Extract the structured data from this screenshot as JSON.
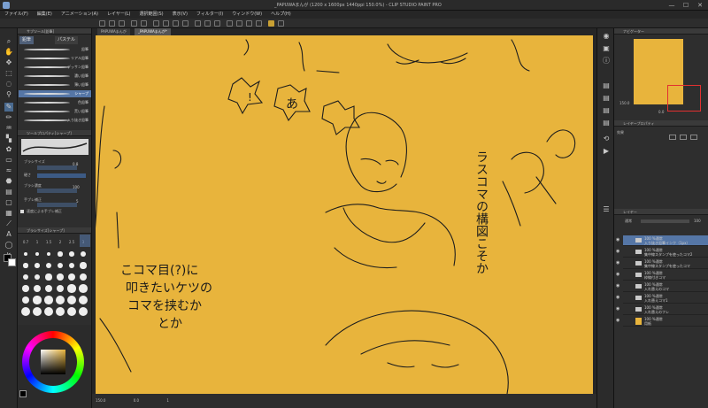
{
  "title": "_PAPUWAまんが (1200 x 1600px 1440ppi 150.0%) - CLIP STUDIO PAINT PRO",
  "menu": [
    "ファイル(F)",
    "編集(E)",
    "アニメーション(A)",
    "レイヤー(L)",
    "選択範囲(S)",
    "表示(V)",
    "フィルター(I)",
    "ウィンドウ(W)",
    "ヘルプ(H)"
  ],
  "window_buttons": [
    "—",
    "☐",
    "✕"
  ],
  "subtool": {
    "title": "サブツール[鉛筆]",
    "tabs": [
      "鉛筆",
      "パステル"
    ],
    "brushes": [
      "鉛筆",
      "リアル鉛筆",
      "デッサン鉛筆",
      "濃い鉛筆",
      "薄い鉛筆",
      "シャープ",
      "色鉛筆",
      "荒い鉛筆",
      "入り抜き鉛筆"
    ],
    "selected": "シャープ"
  },
  "toolprop": {
    "title": "ツールプロパティ[シャープ]",
    "brush_size_label": "ブラシサイズ",
    "brush_size_value": "0.8",
    "hardness_label": "硬さ",
    "density_label": "ブラシ濃度",
    "density_value": "100",
    "stabilization_label": "手ブレ補正",
    "stabilization_value": "5",
    "speed_label": "速度による手ブレ補正"
  },
  "brushsize": {
    "title": "ブラシサイズ[シャープ]",
    "sizes_row1": [
      "0.7",
      "1",
      "1.5",
      "2",
      "2.5",
      "3"
    ],
    "selected": "0.7"
  },
  "tabs": [
    "PAPUWAまんが",
    "_PAPUWAまんが*"
  ],
  "status": {
    "zoom": "150.0",
    "angle": "0.0",
    "value3": "1"
  },
  "canvas_text": {
    "left_line1": "こコマ目(?)に",
    "left_line2": "叩きたいケツの",
    "left_line3": "コマを挟むか",
    "left_line4": "とか",
    "right_vertical": "ラスコマの構図こそか",
    "bubble1": "!",
    "bubble2": "あ"
  },
  "navigator": {
    "title": "ナビゲーター",
    "zoom": "150.0",
    "angle": "0.0"
  },
  "layerprop": {
    "title": "レイヤープロパティ",
    "effect": "効果"
  },
  "layers": {
    "title": "レイヤー",
    "blend": "通常",
    "opacity": "100",
    "items": [
      {
        "name": "100 %通常",
        "sub": "入り抜き鉛筆インク（1px）",
        "selected": true
      },
      {
        "name": "100 %通常",
        "sub": "集中線スタンプを使ったコマ2",
        "selected": false
      },
      {
        "name": "100 %通常",
        "sub": "集中線スタンプを使ったコマ",
        "selected": false
      },
      {
        "name": "100 %通常",
        "sub": "枠線付きコマ",
        "selected": false
      },
      {
        "name": "100 %通常",
        "sub": "入れ替えのコマ",
        "selected": false
      },
      {
        "name": "100 %通常",
        "sub": "入れ替えコマ1",
        "selected": false
      },
      {
        "name": "100 %通常",
        "sub": "入れ替えのフレ",
        "selected": false
      },
      {
        "name": "100 %通常",
        "sub": "用紙",
        "selected": false
      }
    ]
  },
  "colors": {
    "paper": "#e8b43c",
    "accent": "#5576a6",
    "main_color": "#000000"
  }
}
